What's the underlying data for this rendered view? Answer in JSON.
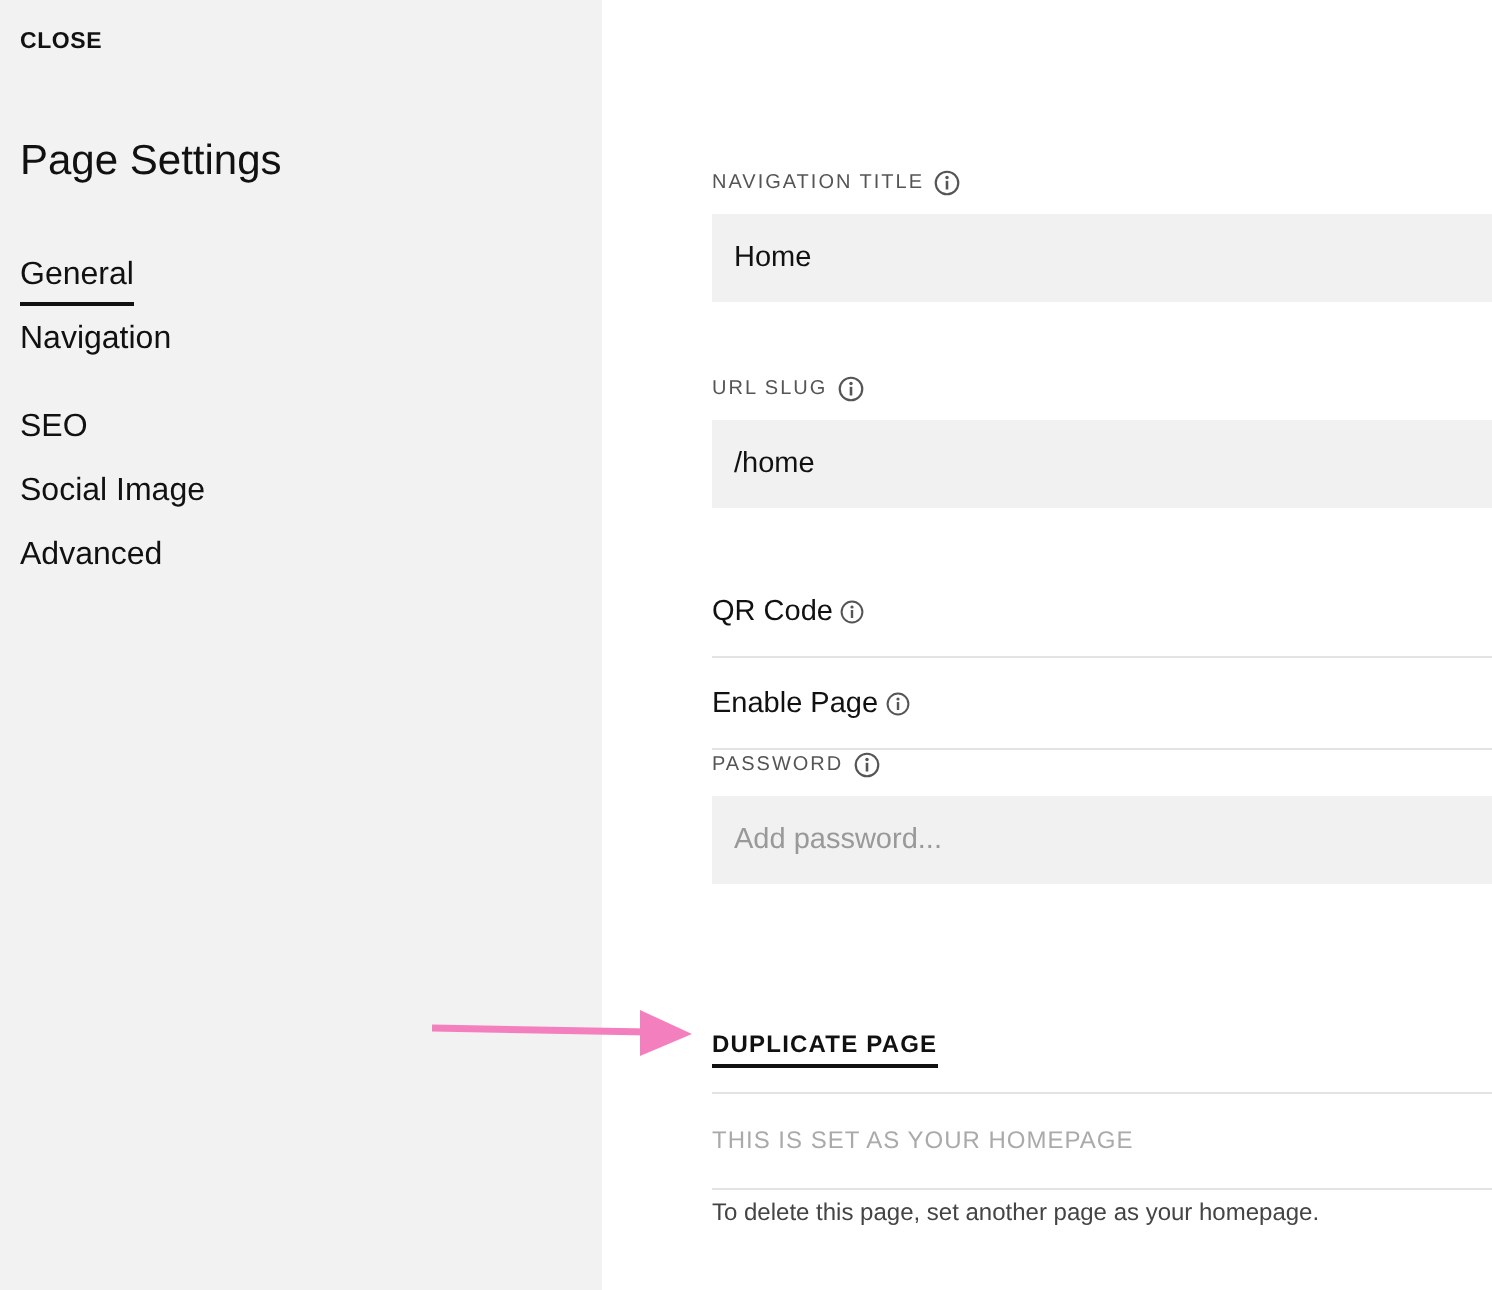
{
  "sidebar": {
    "close": "CLOSE",
    "title": "Page Settings",
    "groups": [
      [
        {
          "label": "General",
          "selected": true
        },
        {
          "label": "Navigation",
          "selected": false
        }
      ],
      [
        {
          "label": "SEO",
          "selected": false
        },
        {
          "label": "Social Image",
          "selected": false
        },
        {
          "label": "Advanced",
          "selected": false
        }
      ]
    ]
  },
  "main": {
    "items": [
      {
        "kind": "field",
        "label": "NAVIGATION TITLE",
        "value": "Home"
      },
      {
        "kind": "field",
        "label": "URL SLUG",
        "value": "/home"
      },
      {
        "kind": "row",
        "label": "QR Code"
      },
      {
        "kind": "row",
        "label": "Enable Page"
      },
      {
        "kind": "field",
        "label": "PASSWORD",
        "placeholder": "Add password..."
      },
      {
        "kind": "action",
        "label": "DUPLICATE PAGE"
      },
      {
        "kind": "note",
        "label": "THIS IS SET AS YOUR HOMEPAGE"
      },
      {
        "kind": "paragraph",
        "label": "To delete this page, set another page as your homepage."
      }
    ]
  }
}
